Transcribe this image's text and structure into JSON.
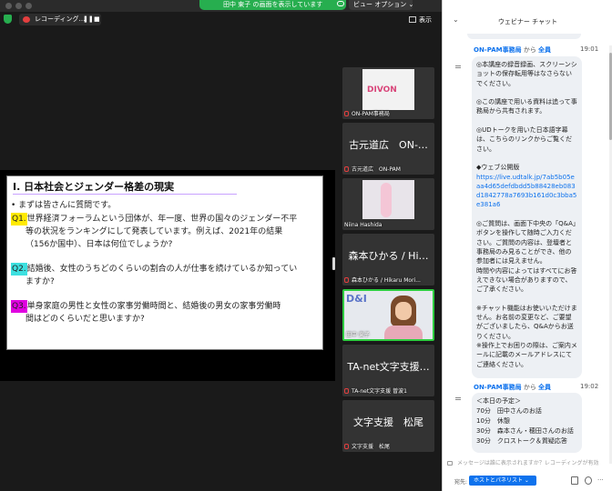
{
  "titlebar": {
    "share_banner": "田中 東子 の画面を表示しています",
    "view_options": "ビュー オプション ⌄"
  },
  "toolbar": {
    "recording": "レコーディング…",
    "pause": "❚❚",
    "stop": "■",
    "view_label": "表示"
  },
  "slide": {
    "title": "Ⅰ. 日本社会とジェンダー格差の現実",
    "intro": "• まずは皆さんに質問です。",
    "q1_label": "Q1.",
    "q1_first": "世界経済フォーラムという団体が、年一度、世界の国々のジェンダー不平",
    "q1_rest": "等の状況をランキングにして発表しています。例えば、2021年の結果\n（156か国中）、日本は何位でしょうか?",
    "q2_label": "Q2.",
    "q2_first": "結婚後、女性のうちどのくらいの割合の人が仕事を続けているか知ってい",
    "q2_rest": "ますか?",
    "q3_label": "Q3.",
    "q3_first": "単身家庭の男性と女性の家事労働時間と、結婚後の男女の家事労働時",
    "q3_rest": "間はどのくらいだと思いますか?"
  },
  "participants": [
    {
      "name": "ON-PAM事務局",
      "big": "",
      "logo": "DIVON"
    },
    {
      "name": "古元道広　ON-PAM",
      "big": "古元道広　ON-…"
    },
    {
      "name": "Niina Hashida",
      "big": ""
    },
    {
      "name": "森本ひかる / Hikaru Mori...",
      "big": "森本ひかる / Hi…"
    },
    {
      "name": "田中 東子",
      "big": "",
      "logo": "D&I"
    },
    {
      "name": "TA-net文字支援 曽波1",
      "big": "TA-net文字支援…"
    },
    {
      "name": "文字支援　松尾",
      "big": "文字支援　松尾"
    }
  ],
  "chat": {
    "header": "ウェビナー チャット",
    "messages": [
      {
        "sender": "ON-PAM事務局",
        "from": " から ",
        "to": "全員",
        "time": "19:01",
        "body1": "◎本講座の録音録画、スクリーンショットの保存転用等はなさらないでください。\n\n◎この講座で用いる資料は追って事務局から共有されます。\n\n◎UDトークを用いた日本語字幕は、こちらのリンクからご覧ください。\n\n◆ウェブ公開版",
        "link": "https://live.udtalk.jp/7ab5b05eaa4d65defdbdd5b88428eb083d1842778a7693b161d0c3bba5e381a6",
        "body2": "◎ご質問は、画面下中央の「Q&A」ボタンを操作して随時ご入力ください。ご質問の内容は、登壇者と事務局のみ見ることができ、他の参加者には見えません。\n時間や内容によってはすべてにお答えできない場合がありますので、ご了承ください。\n\n※チャット機能はお使いいただけません。お名前の変更など、ご要望がございましたら、Q&Aからお送りください。\n※操作上でお困りの際は、ご案内メールに記載のメールアドレスにてご連絡ください。"
      },
      {
        "sender": "ON-PAM事務局",
        "from": " から ",
        "to": "全員",
        "time": "19:02",
        "body1": "＜本日の予定＞\n70分　田中さんのお話\n10分　休憩\n30分　森本さん・穂田さんのお話\n30分　クロストーク＆質疑応答"
      }
    ],
    "input_placeholder": "メッセージは誰に表示されますか？レコーディングが有効",
    "to_label": "宛先:",
    "to_value": "ホストとパネリスト ⌄"
  },
  "colors": {
    "accent": "#0e72ed",
    "share_green": "#27ae4f",
    "active_speaker": "#2ecc40",
    "q1": "#ffea00",
    "q2": "#3de0e0",
    "q3": "#e000e0"
  }
}
